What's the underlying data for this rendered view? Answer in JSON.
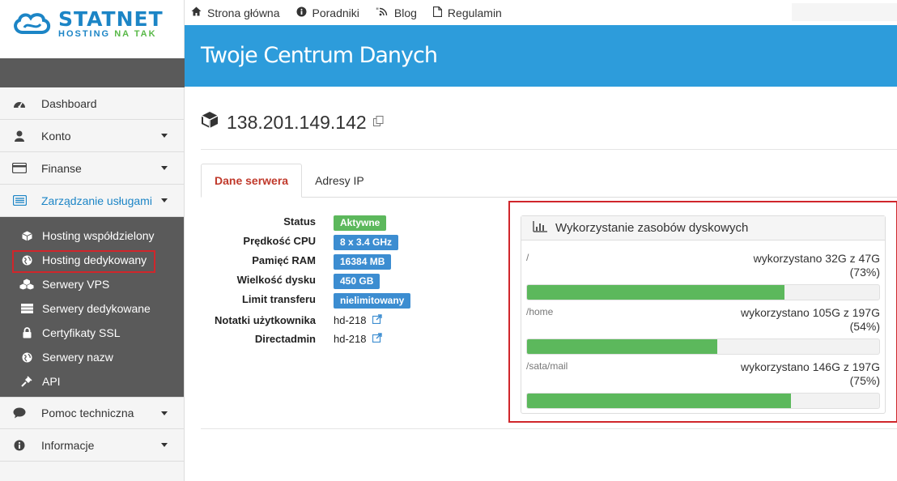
{
  "brand": {
    "name": "STATNET",
    "tagline_main": "HOSTING",
    "tagline_accent": "NA TAK"
  },
  "topbar": {
    "links": [
      {
        "icon": "home-icon",
        "label": "Strona główna"
      },
      {
        "icon": "info-circle-icon",
        "label": "Poradniki"
      },
      {
        "icon": "rss-icon",
        "label": "Blog"
      },
      {
        "icon": "file-icon",
        "label": "Regulamin"
      }
    ]
  },
  "sidebar": {
    "items": [
      {
        "label": "Dashboard",
        "icon": "dashboard-icon"
      },
      {
        "label": "Konto",
        "icon": "user-icon"
      },
      {
        "label": "Finanse",
        "icon": "credit-card-icon"
      },
      {
        "label": "Zarządzanie usługami",
        "icon": "list-icon"
      }
    ],
    "submenu": [
      {
        "label": "Hosting współdzielony",
        "icon": "cube-icon"
      },
      {
        "label": "Hosting dedykowany",
        "icon": "globe-icon"
      },
      {
        "label": "Serwery VPS",
        "icon": "cubes-icon"
      },
      {
        "label": "Serwery dedykowane",
        "icon": "server-icon"
      },
      {
        "label": "Certyfikaty SSL",
        "icon": "lock-icon"
      },
      {
        "label": "Serwery nazw",
        "icon": "globe-icon"
      },
      {
        "label": "API",
        "icon": "plug-icon"
      }
    ],
    "bottom_items": [
      {
        "label": "Pomoc techniczna",
        "icon": "comment-icon"
      },
      {
        "label": "Informacje",
        "icon": "info-circle-icon"
      }
    ]
  },
  "header": {
    "title": "Twoje Centrum Danych"
  },
  "server": {
    "ip": "138.201.149.142"
  },
  "tabs": [
    {
      "label": "Dane serwera"
    },
    {
      "label": "Adresy IP"
    }
  ],
  "details": {
    "status_label": "Status",
    "status_value": "Aktywne",
    "cpu_label": "Prędkość CPU",
    "cpu_value": "8 x 3.4 GHz",
    "ram_label": "Pamięć RAM",
    "ram_value": "16384 MB",
    "disk_label": "Wielkość dysku",
    "disk_value": "450 GB",
    "transfer_label": "Limit transferu",
    "transfer_value": "nielimitowany",
    "notes_label": "Notatki użytkownika",
    "notes_value": "hd-218",
    "da_label": "Directadmin",
    "da_value": "hd-218"
  },
  "disk_panel": {
    "title": "Wykorzystanie zasobów dyskowych",
    "disks": [
      {
        "mount": "/",
        "usage": "wykorzystano 32G z 47G",
        "percent_text": "(73%)",
        "percent": 73
      },
      {
        "mount": "/home",
        "usage": "wykorzystano 105G z 197G",
        "percent_text": "(54%)",
        "percent": 54
      },
      {
        "mount": "/sata/mail",
        "usage": "wykorzystano 146G z 197G",
        "percent_text": "(75%)",
        "percent": 75
      }
    ]
  },
  "colors": {
    "accent": "#2d9cdb",
    "success": "#5cb85c",
    "badge_blue": "#3c8dd1",
    "highlight_red": "#d0262b"
  }
}
